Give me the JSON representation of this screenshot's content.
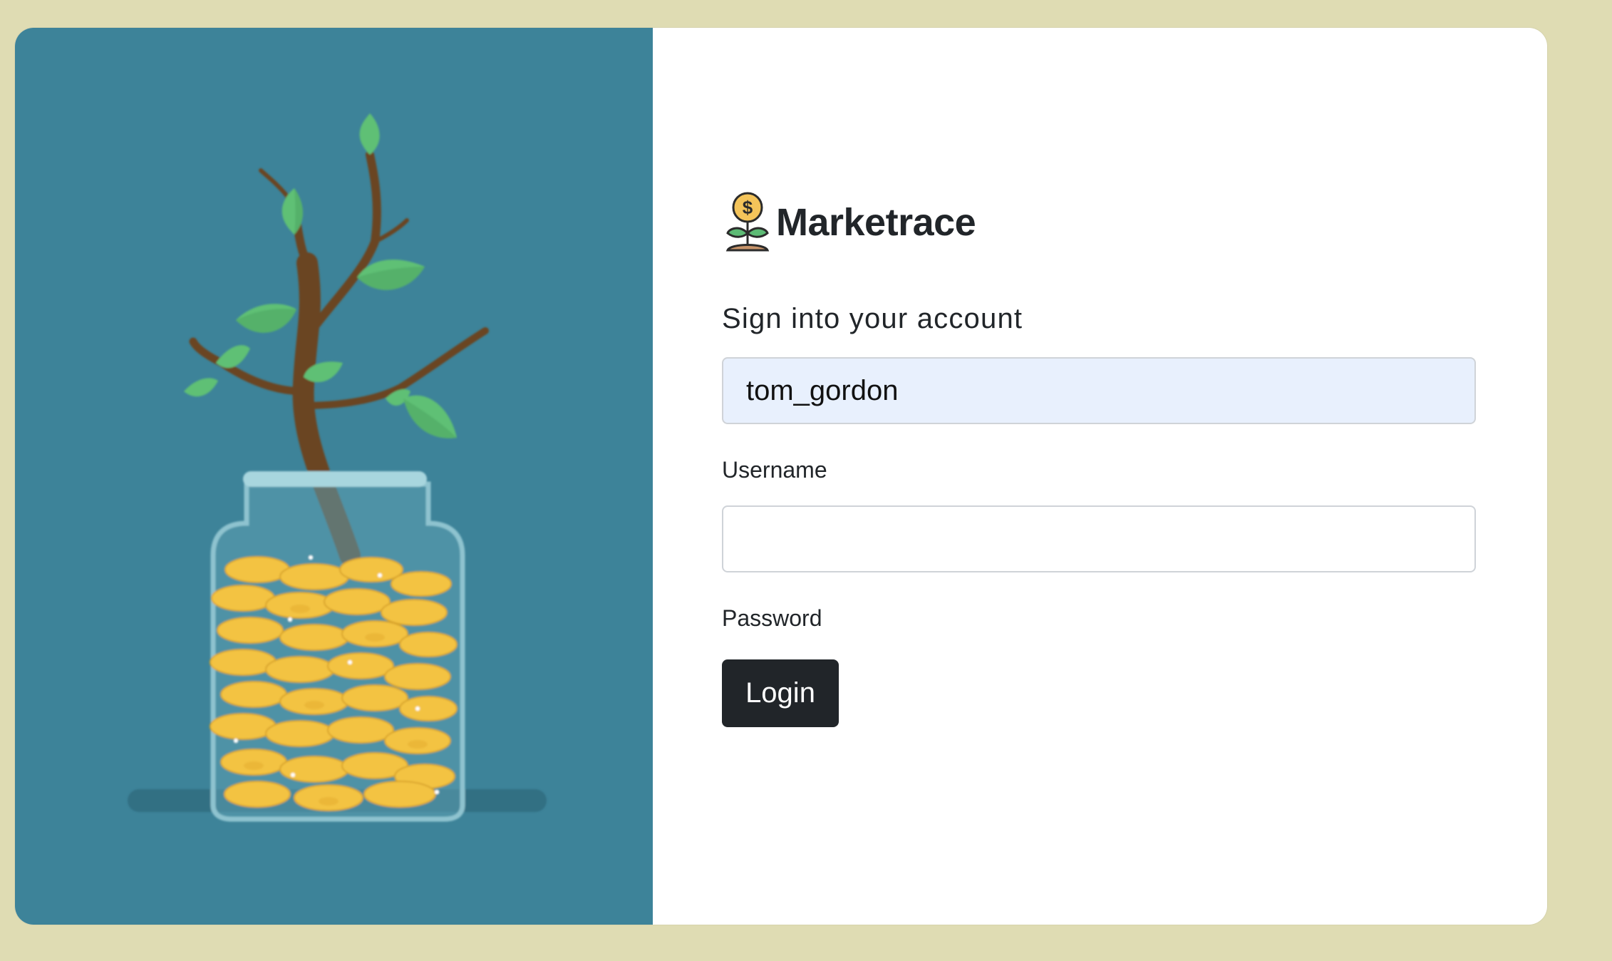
{
  "brand": {
    "name": "Marketrace",
    "icon": "money-plant-icon",
    "colors": {
      "coin": "#f4c45a",
      "leaf": "#5dbb75",
      "soil": "#c8946a"
    }
  },
  "hero": {
    "illustration": "coin-jar-tree-illustration",
    "colors": {
      "background": "#3d8399",
      "leaf": "#5fc074",
      "trunk": "#6b4422",
      "coin": "#f3c343"
    }
  },
  "form": {
    "subtitle": "Sign into your account",
    "username": {
      "value": "tom_gordon",
      "label": "Username",
      "placeholder": ""
    },
    "password": {
      "value": "",
      "label": "Password",
      "placeholder": ""
    },
    "login_label": "Login"
  },
  "colors": {
    "page_background": "#dfdcb3",
    "card_background": "#ffffff",
    "button_background": "#212529",
    "autofill_background": "#e8f0fd"
  }
}
